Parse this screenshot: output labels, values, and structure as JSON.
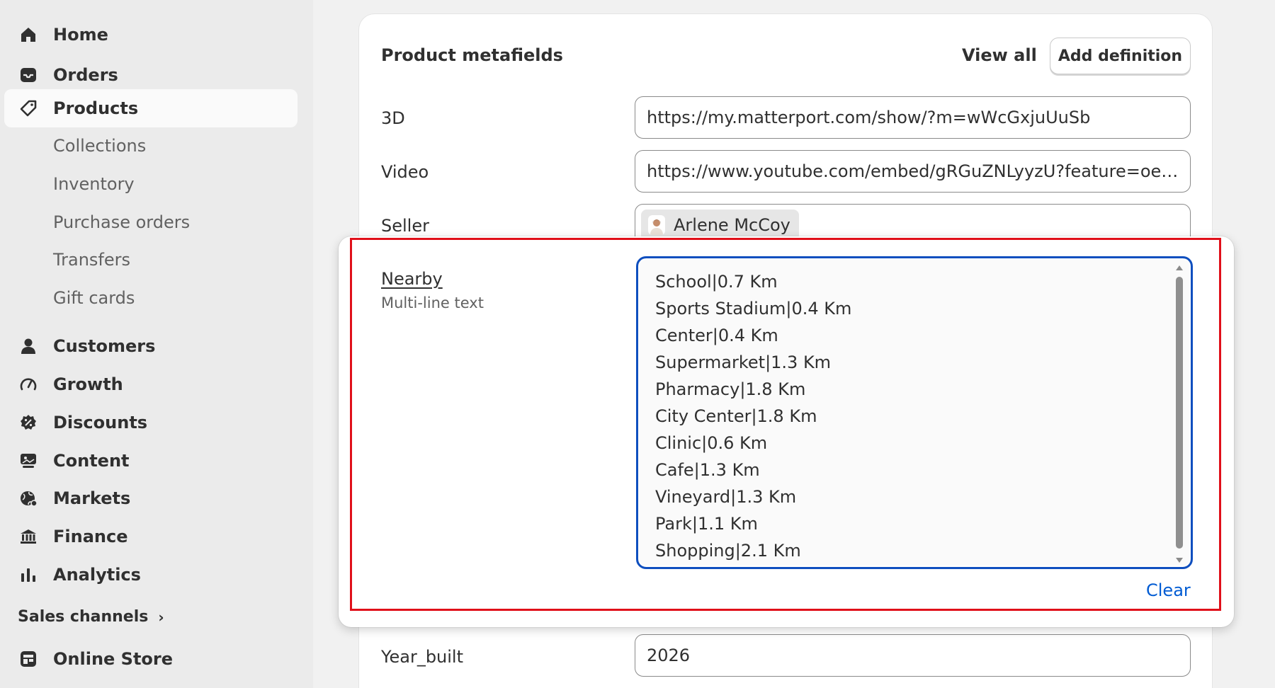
{
  "sidebar": {
    "items": [
      {
        "label": "Home",
        "icon": "home-icon"
      },
      {
        "label": "Orders",
        "icon": "inbox-icon"
      },
      {
        "label": "Products",
        "icon": "tag-icon"
      }
    ],
    "product_subitems": [
      "Collections",
      "Inventory",
      "Purchase orders",
      "Transfers",
      "Gift cards"
    ],
    "items2": [
      {
        "label": "Customers",
        "icon": "person-icon"
      },
      {
        "label": "Growth",
        "icon": "gauge-icon"
      },
      {
        "label": "Discounts",
        "icon": "discount-icon"
      },
      {
        "label": "Content",
        "icon": "content-icon"
      },
      {
        "label": "Markets",
        "icon": "globe-icon"
      },
      {
        "label": "Finance",
        "icon": "bank-icon"
      },
      {
        "label": "Analytics",
        "icon": "bar-chart-icon"
      }
    ],
    "sales_channels_label": "Sales channels",
    "online_store_label": "Online Store"
  },
  "card": {
    "title": "Product metafields",
    "view_all": "View all",
    "add_definition": "Add definition",
    "fields": {
      "three_d": {
        "label": "3D",
        "value": "https://my.matterport.com/show/?m=wWcGxjuUuSb"
      },
      "video": {
        "label": "Video",
        "value": "https://www.youtube.com/embed/gRGuZNLyyzU?feature=oembed"
      },
      "seller": {
        "label": "Seller",
        "value": "Arlene McCoy"
      },
      "year_built": {
        "label": "Year_built",
        "value": "2026"
      }
    }
  },
  "popover": {
    "label": "Nearby",
    "type": "Multi-line text",
    "lines": [
      "School|0.7 Km",
      "Sports Stadium|0.4 Km",
      "Center|0.4 Km",
      "Supermarket|1.3 Km",
      "Pharmacy|1.8 Km",
      "City Center|1.8 Km",
      "Clinic|0.6 Km",
      "Cafe|1.3 Km",
      "Vineyard|1.3 Km",
      "Park|1.1 Km",
      "Shopping|2.1 Km"
    ],
    "clear": "Clear"
  },
  "colors": {
    "highlight": "#e0101a",
    "focus": "#0f4fbf",
    "link": "#005bd3"
  }
}
